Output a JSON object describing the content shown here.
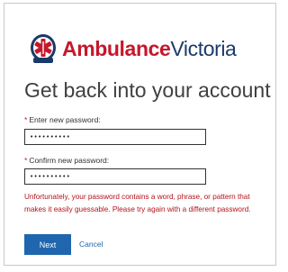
{
  "brand": {
    "name_part1": "Ambulance",
    "name_part2": "Victoria"
  },
  "heading": "Get back into your account",
  "form": {
    "new_password": {
      "label": "Enter new password:",
      "required_marker": "*",
      "value": "••••••••••"
    },
    "confirm_password": {
      "label": "Confirm new password:",
      "required_marker": "*",
      "value": "••••••••••"
    },
    "error_message": "Unfortunately, your password contains a word, phrase, or pattern that makes it easily guessable. Please try again with a different password."
  },
  "actions": {
    "next_label": "Next",
    "cancel_label": "Cancel"
  },
  "colors": {
    "brand_red": "#c5172b",
    "brand_navy": "#1a3a6b",
    "error": "#b5121b",
    "button": "#1f66ae"
  }
}
